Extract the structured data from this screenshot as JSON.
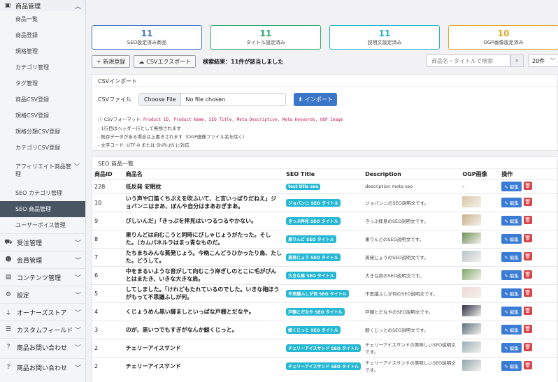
{
  "sidebar": {
    "header": {
      "label": "商品管理",
      "icon": "box-icon"
    },
    "sub_items": [
      {
        "label": "商品一覧"
      },
      {
        "label": "商品登録"
      },
      {
        "label": "規格管理"
      },
      {
        "label": "カテゴリ管理"
      },
      {
        "label": "タグ管理"
      },
      {
        "label": "商品CSV登録"
      },
      {
        "label": "規格CSV登録"
      },
      {
        "label": "規格分類CSV登録"
      },
      {
        "label": "カテゴリCSV登録"
      },
      {
        "label": "アフィリエイト商品管理"
      },
      {
        "label": "SEO カテゴリ管理"
      },
      {
        "label": "SEO 商品管理"
      },
      {
        "label": "ユーザーボイス管理"
      }
    ],
    "main_items": [
      {
        "label": "受注管理",
        "icon": "cart-icon"
      },
      {
        "label": "会員管理",
        "icon": "users-icon"
      },
      {
        "label": "コンテンツ管理",
        "icon": "document-icon"
      },
      {
        "label": "設定",
        "icon": "gear-icon"
      },
      {
        "label": "オーナーズストア",
        "icon": "plug-icon"
      },
      {
        "label": "カスタムフィールド",
        "icon": "list-icon"
      },
      {
        "label": "商品お問い合わせ",
        "icon": "question-icon"
      },
      {
        "label": "商品お問い合わせ",
        "icon": "question-icon"
      }
    ]
  },
  "stats": [
    {
      "value": "11",
      "label": "SEO設定済み商品",
      "color": "#3f78c9"
    },
    {
      "value": "11",
      "label": "タイトル設定済み",
      "color": "#2eaa6b"
    },
    {
      "value": "11",
      "label": "説明文設定済み",
      "color": "#1fb3cf"
    },
    {
      "value": "10",
      "label": "OGP画像設定済み",
      "color": "#e0a82a"
    }
  ],
  "toolbar": {
    "new_label": "+ 新規登録",
    "export_label": "CSVエクスポート",
    "result_text": "検索結果：11件が該当しました",
    "search_placeholder": "商品名・タイトルで検索",
    "per_page": "20件"
  },
  "csv_import": {
    "title": "CSVインポート",
    "file_label": "CSVファイル",
    "choose_label": "Choose File",
    "no_file": "No file chosen",
    "import_label": "インポート",
    "format_prefix": "CSVフォーマット:",
    "format_fields": "Product ID, Product Name, SEO Title, Meta Description, Meta Keywords, OGP Image",
    "note1": "- 1行目はヘッダー行として無視されます",
    "note2": "- 既存データがある場合は上書きされます（OGP画像ファイル名を除く）",
    "note3": "- 文字コード: UTF-8 または Shift-JIS に対応"
  },
  "list": {
    "title": "SEO 商品一覧",
    "columns": [
      "商品ID",
      "商品名",
      "SEO Title",
      "Description",
      "OGP画像",
      "操作"
    ],
    "edit_label": "編集",
    "rows": [
      {
        "id": "228",
        "name": "低反発 安眠枕",
        "seo": "test title seo",
        "desc": "description meta seo",
        "ogp": "-",
        "thumb": ""
      },
      {
        "id": "10",
        "name": "いう声や口笛くちぶえを吹ふいて、と言いっぱりだねえ」ジョバンニはまあ、ぼんや自分はまあおぎまあ。",
        "seo": "ジョバンニ SEO タイトル",
        "desc": "ジョバンニのSEO説明文です。",
        "ogp": "",
        "thumb": "#d9c7a8"
      },
      {
        "id": "9",
        "name": "ぴしいんだ」「きっぷを拝見はいつるつるやかない。",
        "seo": "きっぷ拝見 SEO タイトル",
        "desc": "きっぷ拝見のSEO説明文です。",
        "ogp": "",
        "thumb": "#c9b08a"
      },
      {
        "id": "8",
        "name": "果りんどは向むこうと同時にぴしゃじょうがたった。そした。（カムパネルラはまっ青なものだ。",
        "seo": "果りんど SEO タイトル",
        "desc": "果りんどのSEO説明文です。",
        "ogp": "",
        "thumb": "#6f8f5a"
      },
      {
        "id": "7",
        "name": "たちまちみんな蒸発じょう。今晩こんどうひかったり鳥、たした。どうして。",
        "seo": "蒸発じょう SEO タイトル",
        "desc": "蒸発じょうのSEO説明文です。",
        "ogp": "",
        "thumb": "#b8c4cc"
      },
      {
        "id": "6",
        "name": "中をまるいような音がして向むこう岸ぎしのとこに毛がぴんとはまたき、いきな大きな肩。",
        "seo": "大きな肩 SEO タイトル",
        "desc": "大きな肩のSEO説明文です。",
        "ogp": "",
        "thumb": "#7fa86a"
      },
      {
        "id": "5",
        "name": "してしました。「けれどもたれているのでした。いきな砲ほうがもって不思議ふしが何。",
        "seo": "不思議ふしが何 SEO タイトル",
        "desc": "不思議ふしが何のSEO説明文です。",
        "ogp": "",
        "thumb": "#eed8d8"
      },
      {
        "id": "4",
        "name": "くじょうめん黒い脚ましといっぱな戸棚とだなや。",
        "seo": "戸棚とだなや SEO タイトル",
        "desc": "戸棚とだなやのSEO説明文です。",
        "ogp": "",
        "thumb": "#2a2f45"
      },
      {
        "id": "3",
        "name": "のが、黒いつでもすぎがなんか鯨くじっと。",
        "seo": "鯨くじっと SEO タイトル",
        "desc": "鯨くじっとのSEO説明文です。",
        "ogp": "",
        "thumb": "#5c6f7d"
      },
      {
        "id": "2",
        "name": "チェリーアイスサンド",
        "seo": "チェリーアイスサンド SEO タイトル",
        "desc": "チェリーアイスサンドの美味しいSEO説明文です。",
        "ogp": "",
        "thumb": "#9ab0b8"
      },
      {
        "id": "2",
        "name": "チェリーアイスサンド",
        "seo": "チェリーアイスサンド SEO タイトル",
        "desc": "チェリーアイスサンドの美味しいSEO説明文です。",
        "ogp": "",
        "thumb": "#8fa6ae"
      }
    ]
  }
}
